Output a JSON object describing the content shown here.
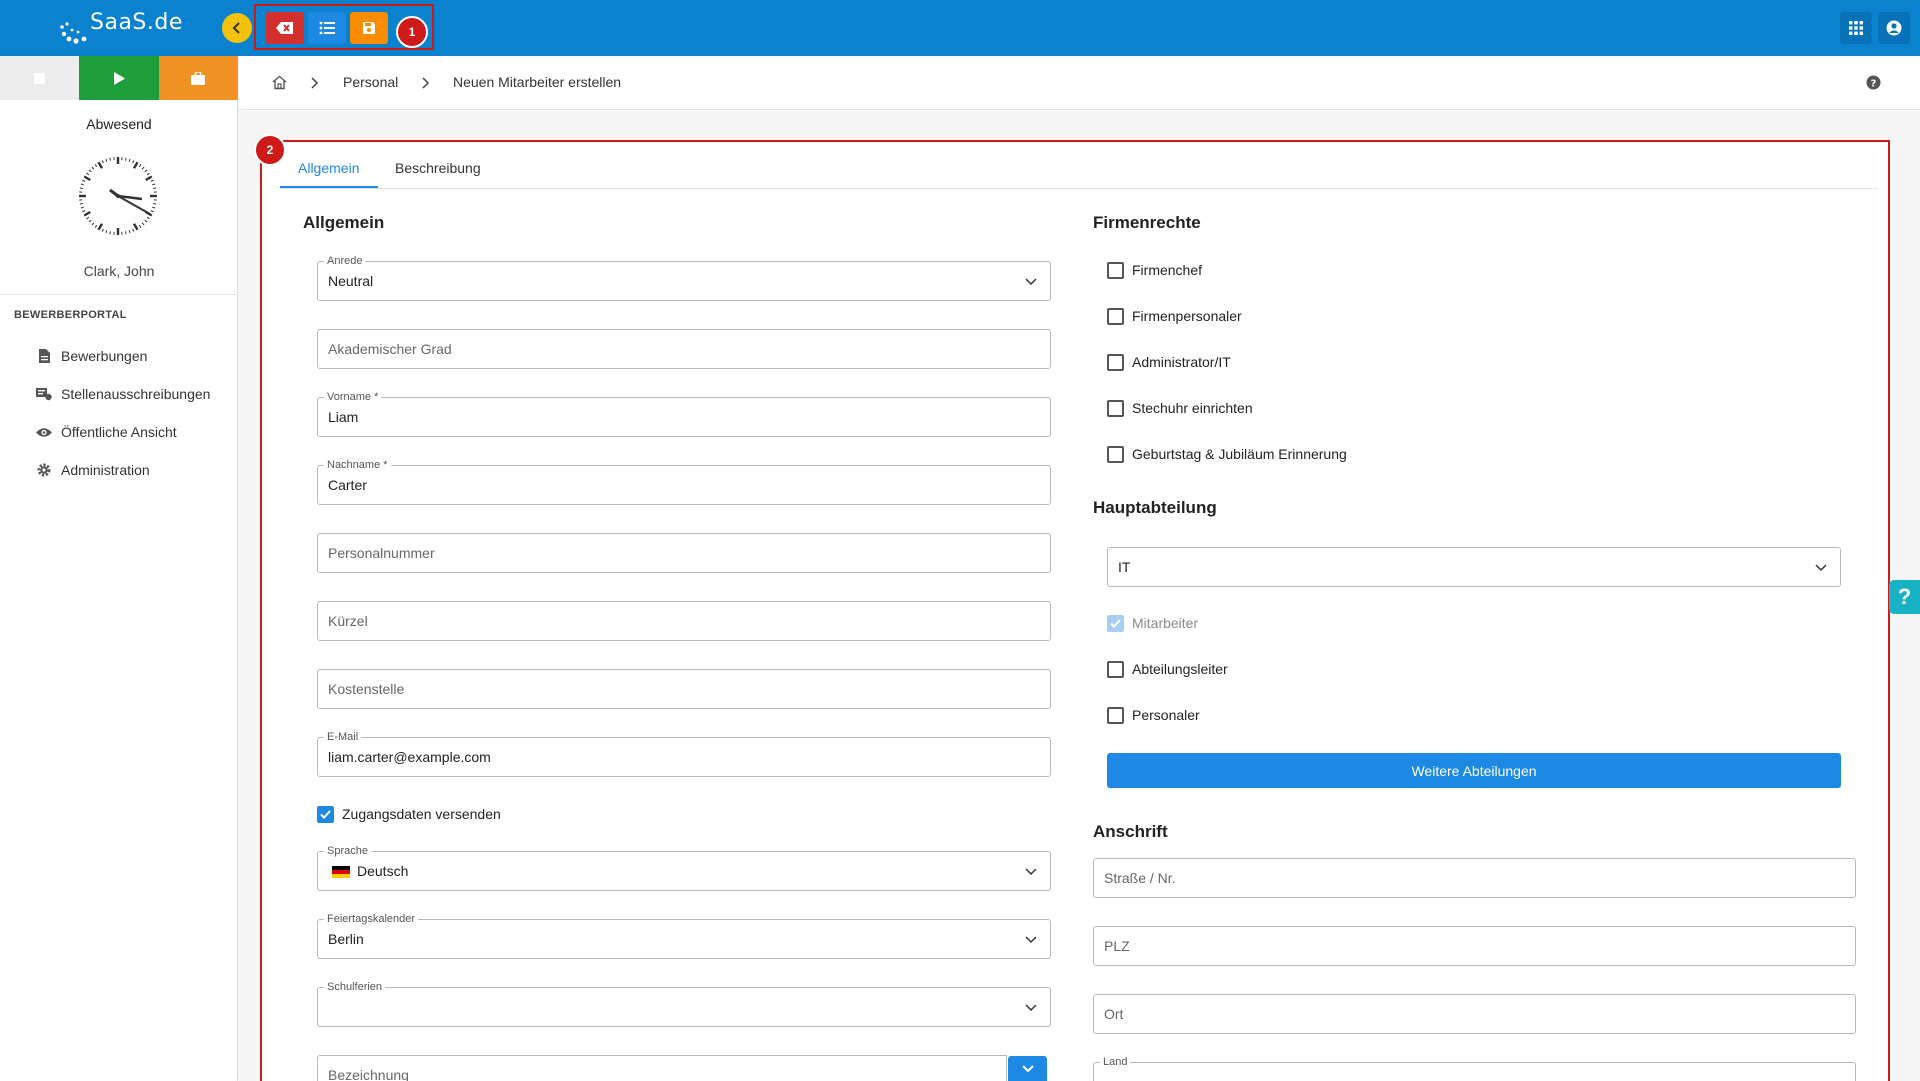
{
  "app": {
    "logo_text": "SaaS.de"
  },
  "toolbar": {
    "badge_1": "1",
    "badge_2": "2",
    "colors": {
      "delete": "#d32f2f",
      "list": "#1e88e5",
      "save": "#fb8c00",
      "header": "#0a82cf"
    }
  },
  "sidebar": {
    "status_label": "Abwesend",
    "user_name": "Clark, John",
    "section": "BEWERBERPORTAL",
    "items": [
      {
        "label": "Bewerbungen",
        "icon": "document-icon"
      },
      {
        "label": "Stellenausschreibungen",
        "icon": "job-posting-icon"
      },
      {
        "label": "Öffentliche Ansicht",
        "icon": "eye-icon"
      },
      {
        "label": "Administration",
        "icon": "gear-icon"
      }
    ]
  },
  "breadcrumb": {
    "level1": "Personal",
    "level2": "Neuen Mitarbeiter erstellen"
  },
  "tabs": [
    {
      "label": "Allgemein"
    },
    {
      "label": "Beschreibung"
    }
  ],
  "allgemein": {
    "title": "Allgemein",
    "anrede": {
      "label": "Anrede",
      "value": "Neutral"
    },
    "akad_grad": {
      "placeholder": "Akademischer Grad"
    },
    "vorname": {
      "label": "Vorname *",
      "value": "Liam"
    },
    "nachname": {
      "label": "Nachname *",
      "value": "Carter"
    },
    "personalnummer": {
      "placeholder": "Personalnummer"
    },
    "kuerzel": {
      "placeholder": "Kürzel"
    },
    "kostenstelle": {
      "placeholder": "Kostenstelle"
    },
    "email": {
      "label": "E-Mail",
      "value": "liam.carter@example.com"
    },
    "zugangsdaten": {
      "label": "Zugangsdaten versenden",
      "checked": true
    },
    "sprache": {
      "label": "Sprache",
      "value": "Deutsch"
    },
    "feiertag": {
      "label": "Feiertagskalender",
      "value": "Berlin"
    },
    "schulferien": {
      "label": "Schulferien",
      "value": ""
    },
    "bezeichnung": {
      "placeholder": "Bezeichnung"
    }
  },
  "firmenrechte": {
    "title": "Firmenrechte",
    "options": [
      {
        "label": "Firmenchef",
        "checked": false
      },
      {
        "label": "Firmenpersonaler",
        "checked": false
      },
      {
        "label": "Administrator/IT",
        "checked": false
      },
      {
        "label": "Stechuhr einrichten",
        "checked": false
      },
      {
        "label": "Geburtstag & Jubiläum Erinnerung",
        "checked": false
      }
    ]
  },
  "hauptabteilung": {
    "title": "Hauptabteilung",
    "value": "IT",
    "mitarbeiter": "Mitarbeiter",
    "abteilungsleiter": "Abteilungsleiter",
    "personaler": "Personaler",
    "button": "Weitere Abteilungen"
  },
  "anschrift": {
    "title": "Anschrift",
    "strasse": {
      "placeholder": "Straße / Nr."
    },
    "plz": {
      "placeholder": "PLZ"
    },
    "ort": {
      "placeholder": "Ort"
    },
    "land": {
      "label": "Land"
    }
  }
}
